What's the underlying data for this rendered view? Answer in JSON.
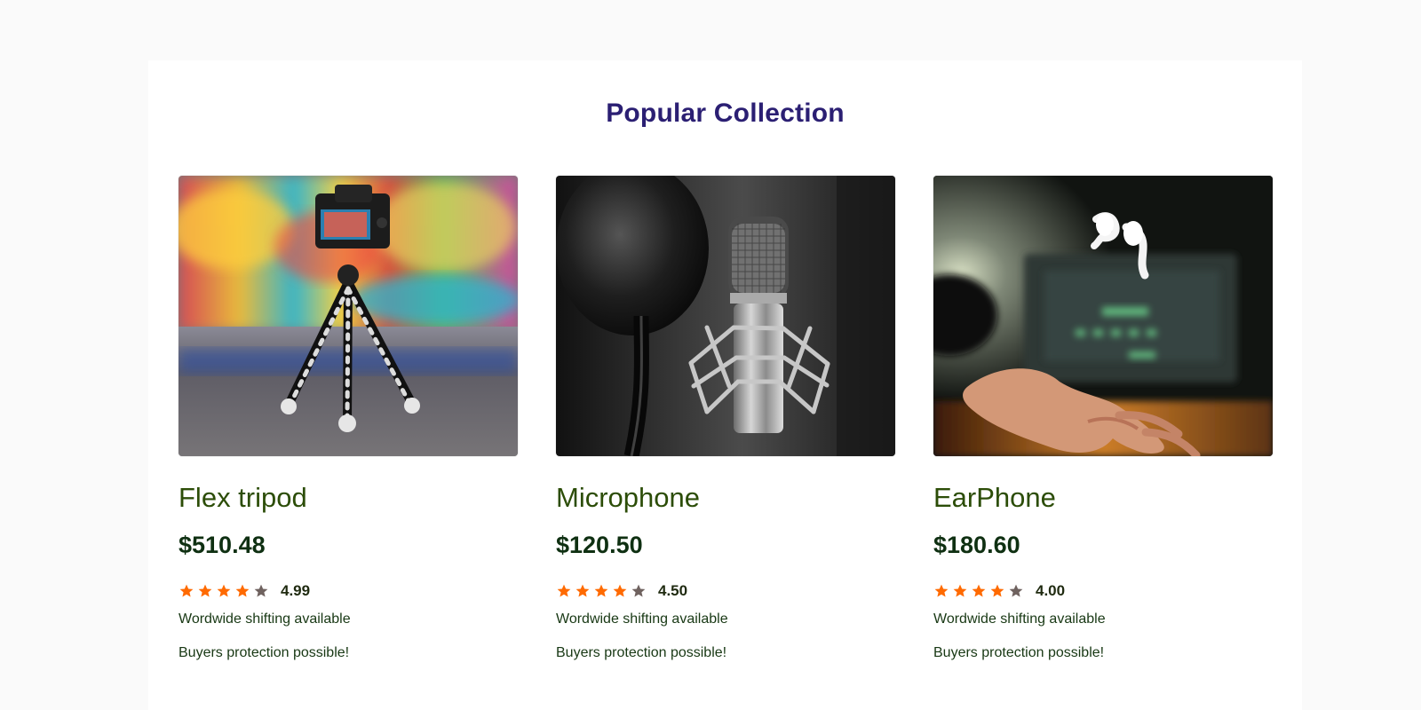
{
  "section": {
    "title": "Popular Collection"
  },
  "products": [
    {
      "name": "Flex tripod",
      "price": "$510.48",
      "rating": "4.99",
      "stars": 4,
      "shipping": "Wordwide shifting available",
      "protection": "Buyers protection possible!",
      "image_icon": "tripod-camera-image"
    },
    {
      "name": "Microphone",
      "price": "$120.50",
      "rating": "4.50",
      "stars": 4,
      "shipping": "Wordwide shifting available",
      "protection": "Buyers protection possible!",
      "image_icon": "microphone-image"
    },
    {
      "name": "EarPhone",
      "price": "$180.60",
      "rating": "4.00",
      "stars": 4,
      "shipping": "Wordwide shifting available",
      "protection": "Buyers protection possible!",
      "image_icon": "earphone-image"
    }
  ],
  "colors": {
    "title": "#2b1f73",
    "product_name": "#2c4d08",
    "price": "#0f3012",
    "star_filled": "#ff6a00",
    "star_empty": "#6f625f"
  }
}
